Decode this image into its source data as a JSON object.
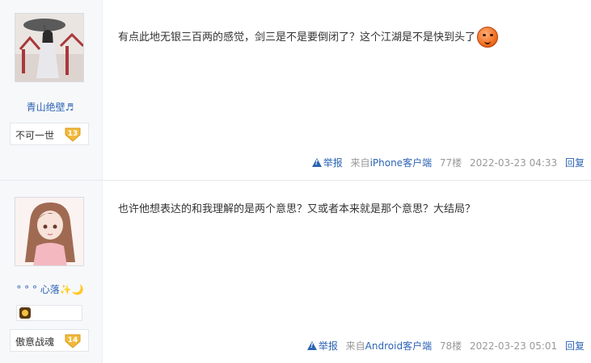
{
  "posts": [
    {
      "username": "青山绝壁♬",
      "badge": {
        "text": "不可一世",
        "level": "13"
      },
      "content": "有点此地无银三百两的感觉，剑三是不是要倒闭了？这个江湖是不是快到头了",
      "meta": {
        "report": "举报",
        "source_prefix": "来自",
        "client": "iPhone客户端",
        "floor": "77楼",
        "time": "2022-03-23 04:33",
        "reply": "回复"
      }
    },
    {
      "username": "° ° ° 心落✨🌙",
      "badge": {
        "text": "傲意战魂",
        "level": "14"
      },
      "content": "也许他想表达的和我理解的是两个意思？又或者本来就是那个意思？大结局？",
      "meta": {
        "report": "举报",
        "source_prefix": "来自",
        "client": "Android客户端",
        "floor": "78楼",
        "time": "2022-03-23 05:01",
        "reply": "回复"
      }
    }
  ],
  "colors": {
    "link": "#2d64b3",
    "meta": "#999999",
    "badge_gold": "#f2b93b"
  }
}
